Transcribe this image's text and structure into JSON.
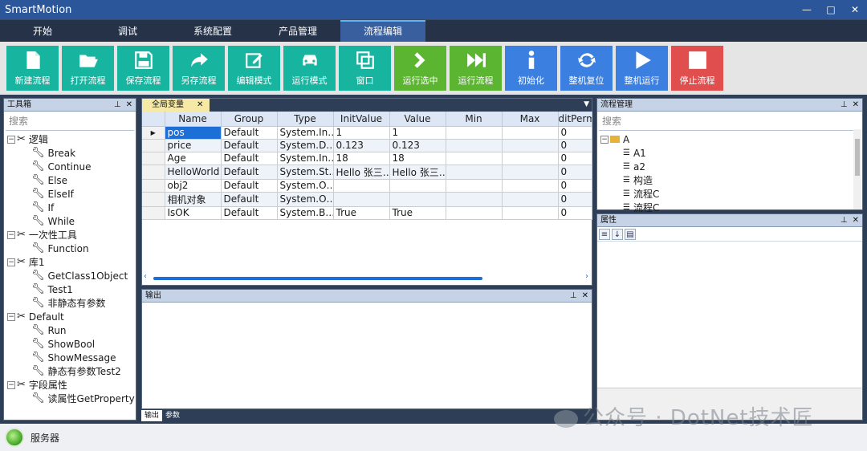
{
  "app": {
    "title": "SmartMotion",
    "win_min": "—",
    "win_max": "□",
    "win_close": "✕"
  },
  "menu": [
    {
      "label": "开始"
    },
    {
      "label": "调试"
    },
    {
      "label": "系统配置"
    },
    {
      "label": "产品管理"
    },
    {
      "label": "流程编辑",
      "active": true
    }
  ],
  "toolbar": [
    {
      "label": "新建流程",
      "icon": "file-icon",
      "color": "#17b4a0"
    },
    {
      "label": "打开流程",
      "icon": "folder-open-icon",
      "color": "#17b4a0"
    },
    {
      "label": "保存流程",
      "icon": "save-icon",
      "color": "#17b4a0"
    },
    {
      "label": "另存流程",
      "icon": "share-arrow-icon",
      "color": "#17b4a0"
    },
    {
      "label": "编辑模式",
      "icon": "edit-icon",
      "color": "#17b4a0"
    },
    {
      "label": "运行模式",
      "icon": "car-icon",
      "color": "#17b4a0"
    },
    {
      "label": "窗口",
      "icon": "window-icon",
      "color": "#17b4a0"
    },
    {
      "label": "运行选中",
      "icon": "chevron-right-icon",
      "color": "#5cb531"
    },
    {
      "label": "运行流程",
      "icon": "fast-forward-icon",
      "color": "#5cb531"
    },
    {
      "label": "初始化",
      "icon": "info-icon",
      "color": "#3b7fe0"
    },
    {
      "label": "整机复位",
      "icon": "refresh-icon",
      "color": "#3b7fe0"
    },
    {
      "label": "整机运行",
      "icon": "play-icon",
      "color": "#3b7fe0"
    },
    {
      "label": "停止流程",
      "icon": "stop-icon",
      "color": "#e04e4e"
    }
  ],
  "toolbox": {
    "title": "工具箱",
    "search_placeholder": "搜索",
    "groups": [
      {
        "label": "逻辑",
        "items": [
          "Break",
          "Continue",
          "Else",
          "ElseIf",
          "If",
          "While"
        ]
      },
      {
        "label": "一次性工具",
        "items": [
          "Function"
        ]
      },
      {
        "label": "库1",
        "items": [
          "GetClass1Object",
          "Test1",
          "非静态有参数"
        ]
      },
      {
        "label": "Default",
        "items": [
          "Run",
          "ShowBool",
          "ShowMessage",
          "静态有参数Test2"
        ]
      },
      {
        "label": "字段属性",
        "items": [
          "读属性GetProperty"
        ]
      }
    ]
  },
  "globals": {
    "tab_label": "全局变量",
    "columns": [
      "Name",
      "Group",
      "Type",
      "InitValue",
      "Value",
      "Min",
      "Max",
      "ditPerm"
    ],
    "rows": [
      [
        "pos",
        "Default",
        "System.In…",
        "1",
        "1",
        "",
        "",
        "0"
      ],
      [
        "price",
        "Default",
        "System.D…",
        "0.123",
        "0.123",
        "",
        "",
        "0"
      ],
      [
        "Age",
        "Default",
        "System.In…",
        "18",
        "18",
        "",
        "",
        "0"
      ],
      [
        "HelloWorld",
        "Default",
        "System.St…",
        "Hello 张三…",
        "Hello 张三…",
        "",
        "",
        "0"
      ],
      [
        "obj2",
        "Default",
        "System.O…",
        "",
        "",
        "",
        "",
        "0"
      ],
      [
        "相机对象",
        "Default",
        "System.O…",
        "",
        "",
        "",
        "",
        "0"
      ],
      [
        "IsOK",
        "Default",
        "System.B…",
        "True",
        "True",
        "",
        "",
        "0"
      ]
    ]
  },
  "output": {
    "title": "输出",
    "tabs": [
      "输出",
      "参数"
    ]
  },
  "flow_manager": {
    "title": "流程管理",
    "search_placeholder": "搜索",
    "root": "A",
    "items": [
      "A1",
      "a2",
      "构造",
      "流程C",
      "流程C"
    ]
  },
  "properties": {
    "title": "属性"
  },
  "status": {
    "label": "服务器"
  },
  "watermark": "公众号 · DotNet技术匠"
}
